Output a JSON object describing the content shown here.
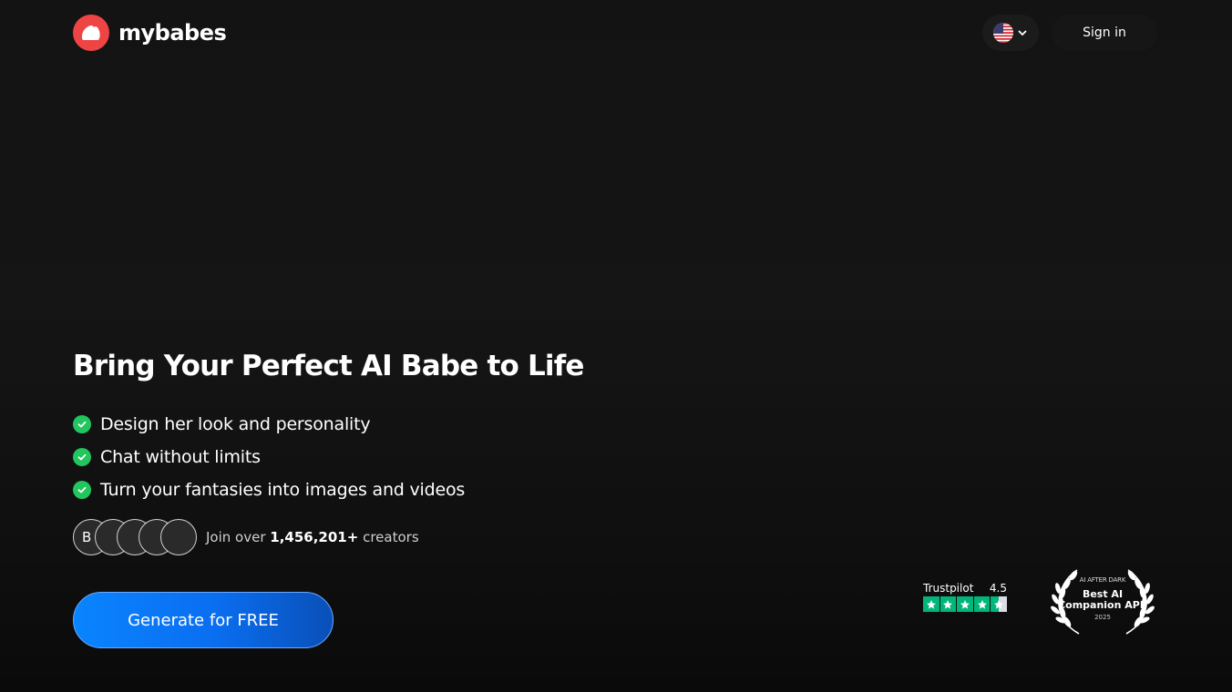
{
  "header": {
    "brand": "mybabes",
    "language_icon": "us-flag-icon",
    "signin_label": "Sign in"
  },
  "hero": {
    "title": "Bring Your Perfect AI Babe to Life",
    "features": [
      "Design her look and personality",
      "Chat without limits",
      "Turn your fantasies into images and videos"
    ],
    "avatars": [
      "B",
      "",
      "",
      "",
      ""
    ],
    "social_prefix": "Join over",
    "social_count": "1,456,201+",
    "social_suffix": "creators",
    "cta_label": "Generate for FREE"
  },
  "badges": {
    "trustpilot_label": "Trustpilot",
    "trustpilot_score": "4.5",
    "trustpilot_stars": 4.5,
    "award_org": "AI AFTER DARK",
    "award_line1": "Best AI",
    "award_line2": "Companion APP",
    "award_year": "2025"
  },
  "colors": {
    "brand_red": "#ef4444",
    "check_green": "#22c55e",
    "cta_blue": "#0a84ff",
    "trustpilot_green": "#00b67a",
    "background": "#121212"
  }
}
